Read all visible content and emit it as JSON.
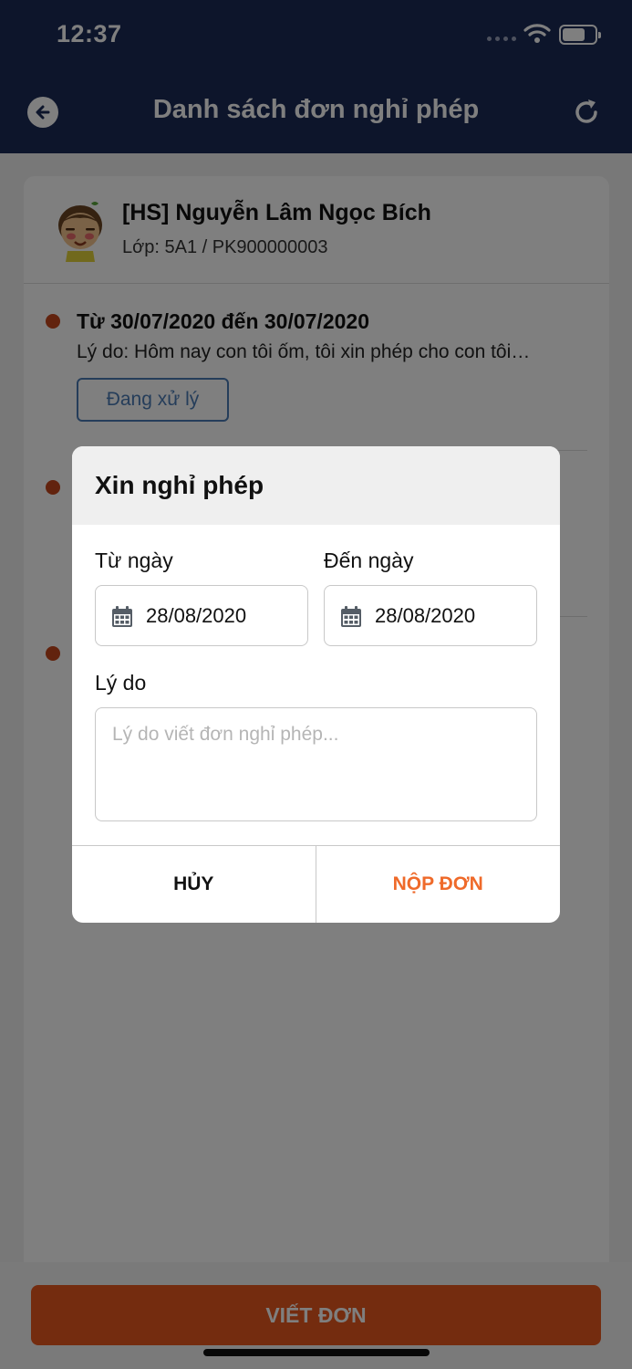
{
  "status_bar": {
    "time": "12:37"
  },
  "header": {
    "title": "Danh sách đơn nghỉ phép"
  },
  "student": {
    "name": "[HS] Nguyễn Lâm Ngọc Bích",
    "class_info": "Lớp: 5A1 / PK900000003"
  },
  "entries": [
    {
      "date_range": "Từ 30/07/2020 đến 30/07/2020",
      "reason": "Lý do: Hôm nay con tôi ốm, tôi xin phép cho con tôi…",
      "status": "Đang xử lý"
    }
  ],
  "dialog": {
    "title": "Xin nghỉ phép",
    "from_label": "Từ ngày",
    "from_value": "28/08/2020",
    "to_label": "Đến ngày",
    "to_value": "28/08/2020",
    "reason_label": "Lý do",
    "reason_placeholder": "Lý do viết đơn nghỉ phép...",
    "cancel_label": "HỦY",
    "submit_label": "NỘP ĐƠN"
  },
  "bottom": {
    "write_button_label": "VIẾT ĐƠN"
  },
  "colors": {
    "header_bg": "#1b2a57",
    "accent_orange": "#e9581f",
    "status_blue": "#4a7bb5",
    "bullet": "#c4471c"
  }
}
